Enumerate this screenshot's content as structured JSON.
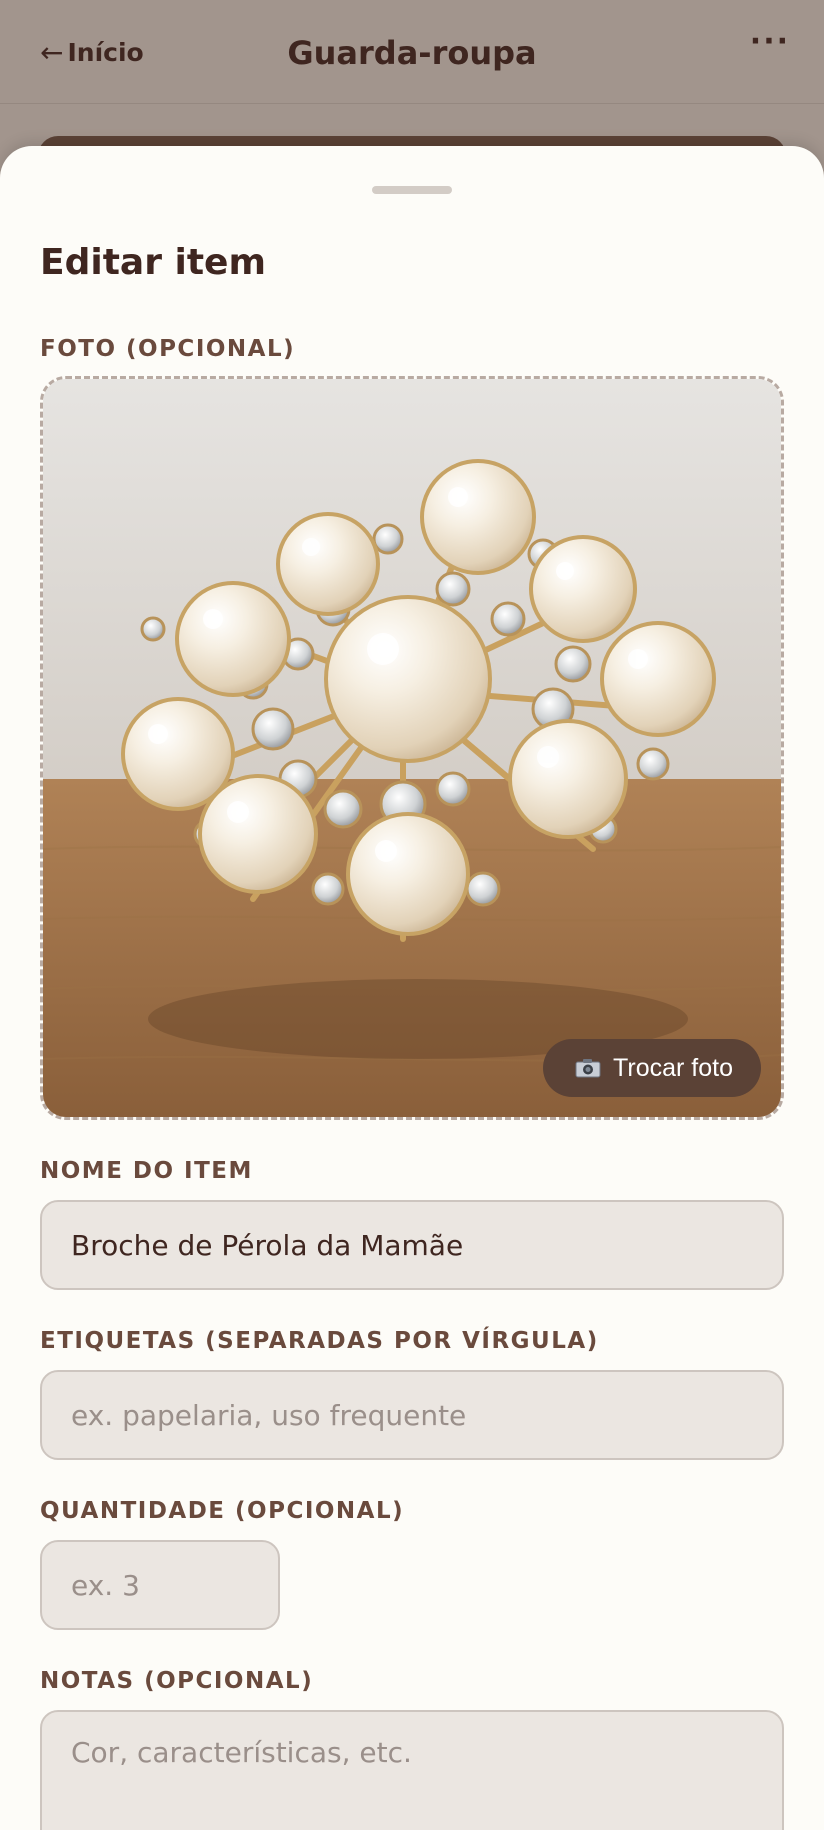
{
  "header": {
    "back_arrow": "←",
    "back_label": "Início",
    "title": "Guarda-roupa",
    "more_icon": "⋮"
  },
  "sheet": {
    "title": "Editar item",
    "photo": {
      "label": "FOTO (OPCIONAL)",
      "image_alt": "Broche de pérolas dourado com cristais sobre mesa de madeira",
      "change_button": "Trocar foto",
      "camera_icon": "camera-icon"
    },
    "name": {
      "label": "NOME DO ITEM",
      "value": "Broche de Pérola da Mamãe"
    },
    "tags": {
      "label": "ETIQUETAS (SEPARADAS POR VÍRGULA)",
      "placeholder": "ex. papelaria, uso frequente"
    },
    "quantity": {
      "label": "QUANTIDADE (OPCIONAL)",
      "placeholder": "ex. 3"
    },
    "notes": {
      "label": "NOTAS (OPCIONAL)",
      "placeholder": "Cor, características, etc."
    }
  },
  "colors": {
    "accent": "#5b4236",
    "text": "#3f2620",
    "label": "#6a4a3d",
    "sheet_bg": "#fdfcf8",
    "input_bg": "#ebe6e1",
    "backdrop": "#a2958d"
  }
}
